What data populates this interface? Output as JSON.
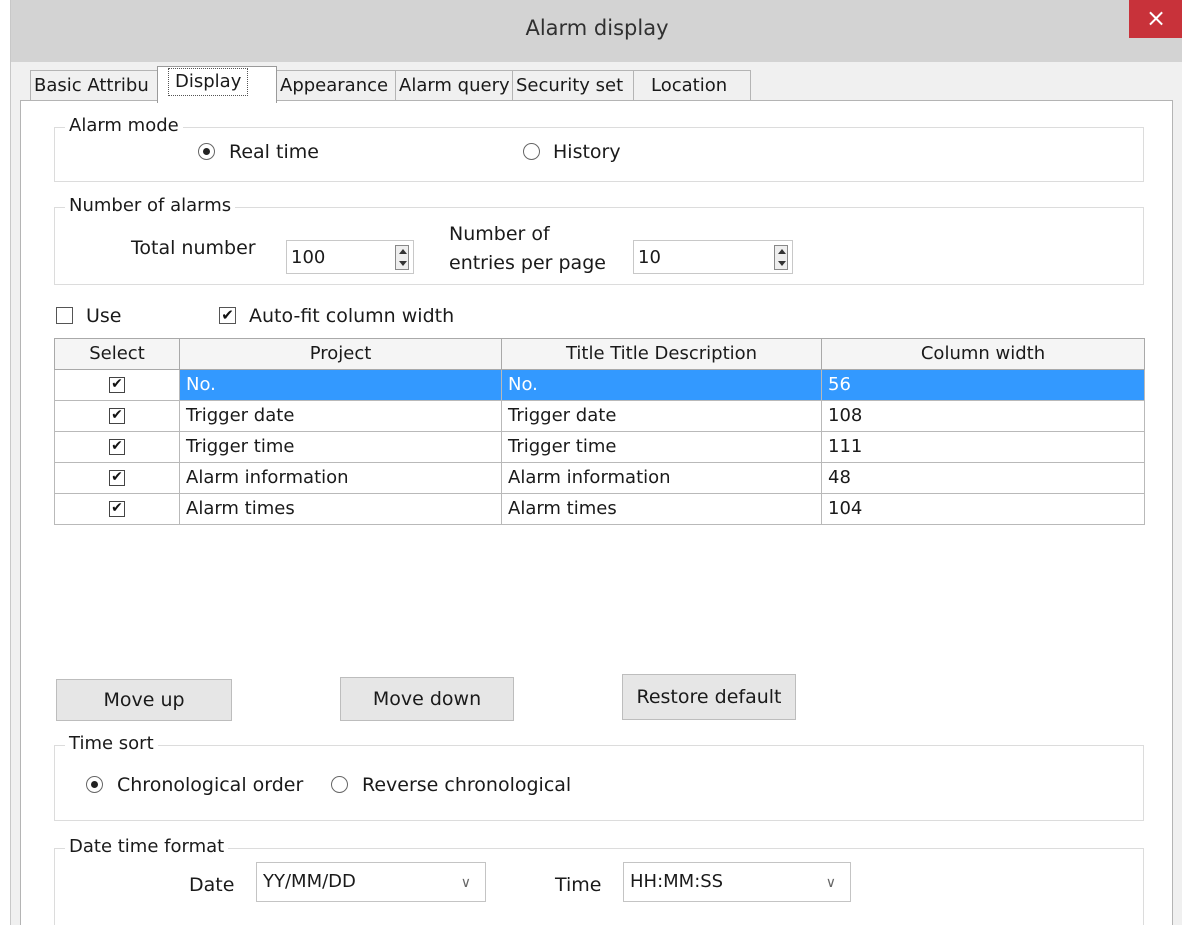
{
  "window": {
    "title": "Alarm display",
    "close_label": "×"
  },
  "tabs": [
    {
      "label": "Basic Attribu",
      "active": false
    },
    {
      "label": "Display",
      "active": true
    },
    {
      "label": "Appearance",
      "active": false
    },
    {
      "label": "Alarm query",
      "active": false
    },
    {
      "label": "Security set",
      "active": false
    },
    {
      "label": "Location",
      "active": false
    }
  ],
  "alarm_mode": {
    "legend": "Alarm mode",
    "options": [
      {
        "label": "Real time",
        "selected": true
      },
      {
        "label": "History",
        "selected": false
      }
    ]
  },
  "number_of_alarms": {
    "legend": "Number of alarms",
    "total_label": "Total number",
    "total_value": "100",
    "per_page_label_line1": "Number of",
    "per_page_label_line2": "entries per page",
    "per_page_value": "10"
  },
  "options": {
    "use_label": "Use",
    "use_checked": false,
    "autofit_label": "Auto-fit column width",
    "autofit_checked": true
  },
  "table": {
    "headers": [
      "Select",
      "Project",
      "Title  Title Description",
      "Column width"
    ],
    "selected_row": 0,
    "rows": [
      {
        "checked": true,
        "project": "No.",
        "title": "No.",
        "width": "56"
      },
      {
        "checked": true,
        "project": "Trigger date",
        "title": "Trigger date",
        "width": "108"
      },
      {
        "checked": true,
        "project": "Trigger time",
        "title": "Trigger time",
        "width": "111"
      },
      {
        "checked": true,
        "project": "Alarm information",
        "title": "Alarm information",
        "width": "48"
      },
      {
        "checked": true,
        "project": "Alarm times",
        "title": "Alarm times",
        "width": "104"
      }
    ]
  },
  "buttons": {
    "move_up": "Move up",
    "move_down": "Move down",
    "restore_default": "Restore default"
  },
  "time_sort": {
    "legend": "Time sort",
    "options": [
      {
        "label": "Chronological order",
        "selected": true
      },
      {
        "label": "Reverse chronological",
        "selected": false
      }
    ]
  },
  "date_time_format": {
    "legend": "Date time format",
    "date_label": "Date",
    "date_value": "YY/MM/DD",
    "time_label": "Time",
    "time_value": "HH:MM:SS"
  },
  "icons": {
    "check_glyph": "✔",
    "dropdown_glyph": "∨"
  },
  "colors": {
    "selection": "#3399ff",
    "close_button": "#c8323a"
  }
}
